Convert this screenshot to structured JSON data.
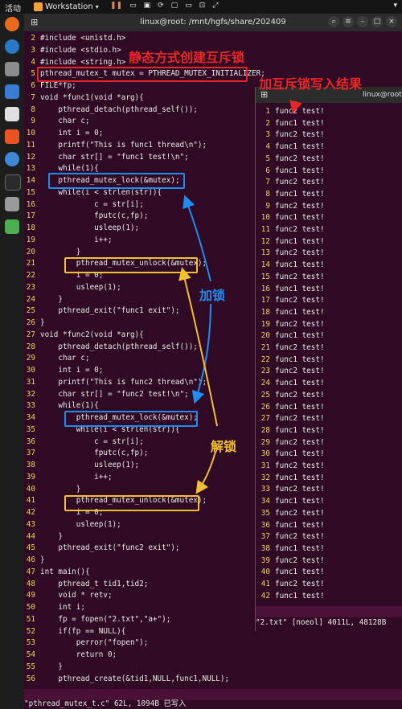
{
  "topbar": {
    "activities": "活动",
    "vm_label": "Workstation",
    "vm_chevron": "▾"
  },
  "terminal1": {
    "title": "linux@root: /mnt/hgfs/share/202409",
    "lines": [
      {
        "n": "2",
        "t": "#include <unistd.h>"
      },
      {
        "n": "3",
        "t": "#include <stdio.h>"
      },
      {
        "n": "4",
        "t": "#include <string.h>"
      },
      {
        "n": "5",
        "t": "pthread_mutex_t mutex = PTHREAD_MUTEX_INITIALIZER;"
      },
      {
        "n": "6",
        "t": "FILE*fp;"
      },
      {
        "n": "7",
        "t": "void *func1(void *arg){"
      },
      {
        "n": "8",
        "t": "    pthread_detach(pthread_self());"
      },
      {
        "n": "9",
        "t": "    char c;"
      },
      {
        "n": "10",
        "t": "    int i = 0;"
      },
      {
        "n": "11",
        "t": "    printf(\"This is func1 thread\\n\");"
      },
      {
        "n": "12",
        "t": "    char str[] = \"func1 test!\\n\";"
      },
      {
        "n": "13",
        "t": "    while(1){"
      },
      {
        "n": "14",
        "t": "    pthread_mutex_lock(&mutex);"
      },
      {
        "n": "15",
        "t": "    while(i < strlen(str)){"
      },
      {
        "n": "16",
        "t": "            c = str[i];"
      },
      {
        "n": "17",
        "t": "            fputc(c,fp);"
      },
      {
        "n": "18",
        "t": "            usleep(1);"
      },
      {
        "n": "19",
        "t": "            i++;"
      },
      {
        "n": "20",
        "t": "        }"
      },
      {
        "n": "21",
        "t": "        pthread_mutex_unlock(&mutex);"
      },
      {
        "n": "22",
        "t": "        i = 0;"
      },
      {
        "n": "23",
        "t": "        usleep(1);"
      },
      {
        "n": "24",
        "t": "    }"
      },
      {
        "n": "25",
        "t": "    pthread_exit(\"func1 exit\");"
      },
      {
        "n": "26",
        "t": "}"
      },
      {
        "n": "27",
        "t": "void *func2(void *arg){"
      },
      {
        "n": "28",
        "t": "    pthread_detach(pthread_self());"
      },
      {
        "n": "29",
        "t": "    char c;"
      },
      {
        "n": "30",
        "t": "    int i = 0;"
      },
      {
        "n": "31",
        "t": "    printf(\"This is func2 thread\\n\");"
      },
      {
        "n": "32",
        "t": "    char str[] = \"func2 test!\\n\";"
      },
      {
        "n": "33",
        "t": "    while(1){"
      },
      {
        "n": "34",
        "t": "        pthread_mutex_lock(&mutex);"
      },
      {
        "n": "35",
        "t": "        while(i < strlen(str)){"
      },
      {
        "n": "36",
        "t": "            c = str[i];"
      },
      {
        "n": "37",
        "t": "            fputc(c,fp);"
      },
      {
        "n": "38",
        "t": "            usleep(1);"
      },
      {
        "n": "39",
        "t": "            i++;"
      },
      {
        "n": "40",
        "t": "        }"
      },
      {
        "n": "41",
        "t": "        pthread_mutex_unlock(&mutex);"
      },
      {
        "n": "42",
        "t": "        i = 0;"
      },
      {
        "n": "43",
        "t": "        usleep(1);"
      },
      {
        "n": "44",
        "t": "    }"
      },
      {
        "n": "45",
        "t": "    pthread_exit(\"func2 exit\");"
      },
      {
        "n": "46",
        "t": "}"
      },
      {
        "n": "47",
        "t": "int main(){"
      },
      {
        "n": "48",
        "t": "    pthread_t tid1,tid2;"
      },
      {
        "n": "49",
        "t": "    void * retv;"
      },
      {
        "n": "50",
        "t": "    int i;"
      },
      {
        "n": "51",
        "t": "    fp = fopen(\"2.txt\",\"a+\");"
      },
      {
        "n": "52",
        "t": "    if(fp == NULL){"
      },
      {
        "n": "53",
        "t": "        perror(\"fopen\");"
      },
      {
        "n": "54",
        "t": "        return 0;"
      },
      {
        "n": "55",
        "t": "    }"
      },
      {
        "n": "56",
        "t": "    pthread_create(&tid1,NULL,func1,NULL);"
      }
    ],
    "cmdline": "\"pthread_mutex_t.c\" 62L, 1094B 已写入"
  },
  "terminal2": {
    "title": "linux@root:",
    "lines": [
      {
        "n": "1",
        "t": "func2 test!"
      },
      {
        "n": "2",
        "t": "func1 test!"
      },
      {
        "n": "3",
        "t": "func2 test!"
      },
      {
        "n": "4",
        "t": "func1 test!"
      },
      {
        "n": "5",
        "t": "func2 test!"
      },
      {
        "n": "6",
        "t": "func1 test!"
      },
      {
        "n": "7",
        "t": "func2 test!"
      },
      {
        "n": "8",
        "t": "func1 test!"
      },
      {
        "n": "9",
        "t": "func2 test!"
      },
      {
        "n": "10",
        "t": "func1 test!"
      },
      {
        "n": "11",
        "t": "func2 test!"
      },
      {
        "n": "12",
        "t": "func1 test!"
      },
      {
        "n": "13",
        "t": "func2 test!"
      },
      {
        "n": "14",
        "t": "func1 test!"
      },
      {
        "n": "15",
        "t": "func2 test!"
      },
      {
        "n": "16",
        "t": "func1 test!"
      },
      {
        "n": "17",
        "t": "func2 test!"
      },
      {
        "n": "18",
        "t": "func1 test!"
      },
      {
        "n": "19",
        "t": "func2 test!"
      },
      {
        "n": "20",
        "t": "func1 test!"
      },
      {
        "n": "21",
        "t": "func2 test!"
      },
      {
        "n": "22",
        "t": "func1 test!"
      },
      {
        "n": "23",
        "t": "func2 test!"
      },
      {
        "n": "24",
        "t": "func1 test!"
      },
      {
        "n": "25",
        "t": "func2 test!"
      },
      {
        "n": "26",
        "t": "func1 test!"
      },
      {
        "n": "27",
        "t": "func2 test!"
      },
      {
        "n": "28",
        "t": "func1 test!"
      },
      {
        "n": "29",
        "t": "func2 test!"
      },
      {
        "n": "30",
        "t": "func1 test!"
      },
      {
        "n": "31",
        "t": "func2 test!"
      },
      {
        "n": "32",
        "t": "func1 test!"
      },
      {
        "n": "33",
        "t": "func2 test!"
      },
      {
        "n": "34",
        "t": "func1 test!"
      },
      {
        "n": "35",
        "t": "func2 test!"
      },
      {
        "n": "36",
        "t": "func1 test!"
      },
      {
        "n": "37",
        "t": "func2 test!"
      },
      {
        "n": "38",
        "t": "func1 test!"
      },
      {
        "n": "39",
        "t": "func2 test!"
      },
      {
        "n": "40",
        "t": "func1 test!"
      },
      {
        "n": "41",
        "t": "func2 test!"
      },
      {
        "n": "42",
        "t": "func1 test!"
      }
    ],
    "cmdline": "\"2.txt\" [noeol] 4011L, 48128B"
  },
  "annotations": {
    "static_mutex": "静态方式创建互斥锁",
    "write_result": "加互斥锁写入结果",
    "lock": "加锁",
    "unlock": "解锁"
  },
  "colors": {
    "red": "#e8262a",
    "blue": "#1e8cf0",
    "yellow": "#f2c12e",
    "bg": "#300a24",
    "linenum": "#f0d55a"
  }
}
